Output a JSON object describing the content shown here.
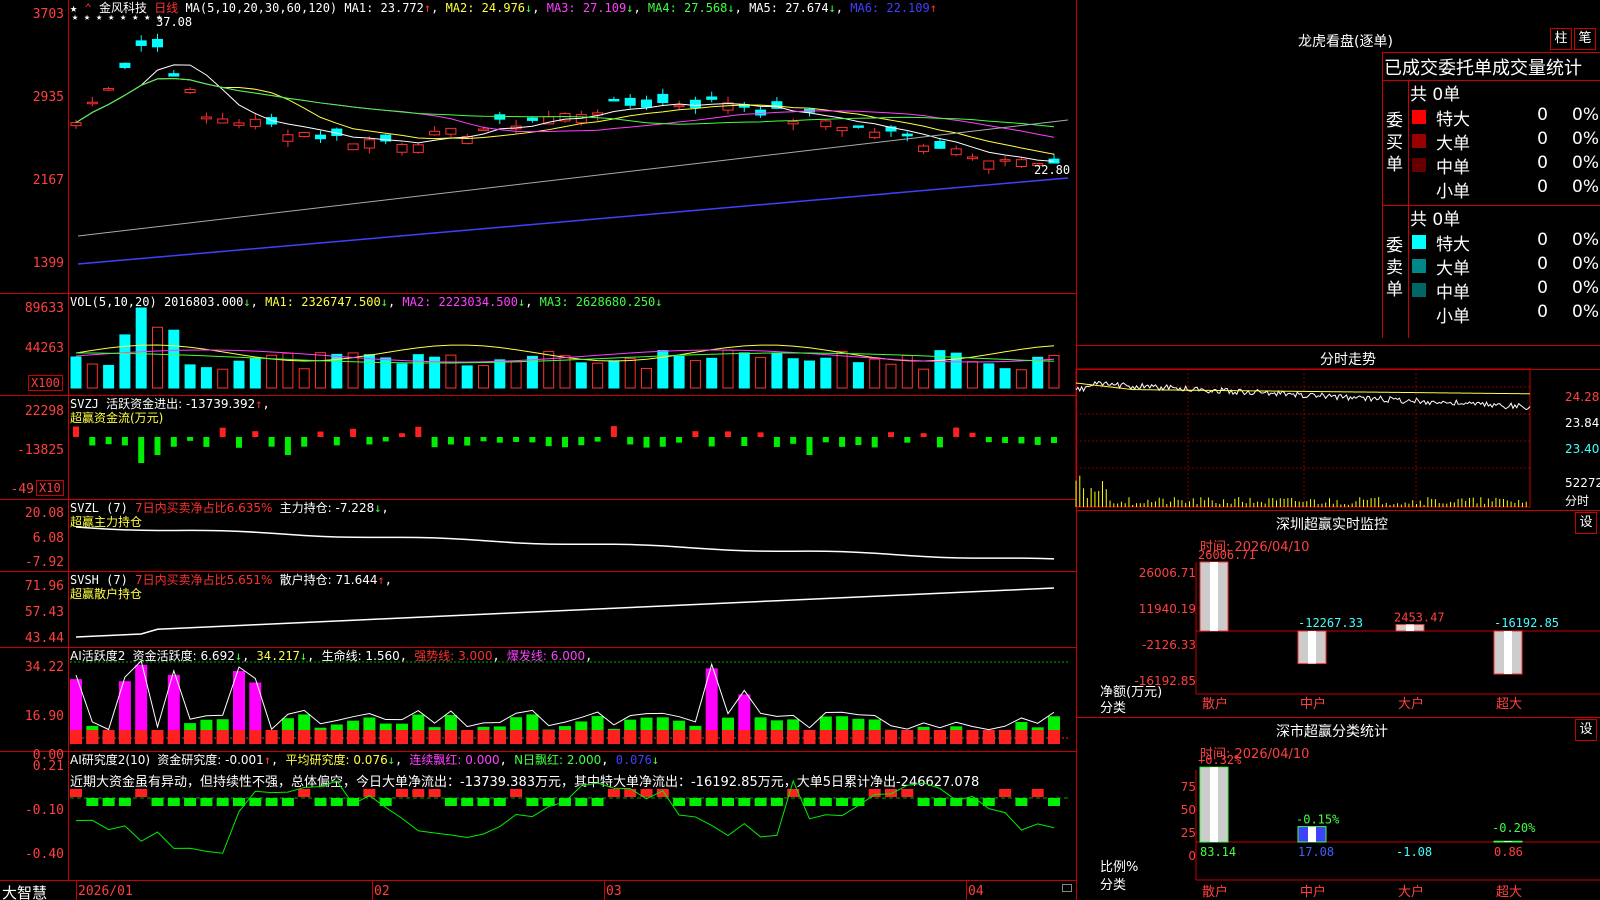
{
  "main_chart": {
    "stock_name": "金风科技",
    "period": "日线",
    "ma_prefix": "MA(5,10,20,30,60,120)",
    "ma1": "MA1: 23.772",
    "ma2": "MA2: 24.976",
    "ma3": "MA3: 27.109",
    "ma4": "MA4: 27.568",
    "ma5": "MA5: 27.674",
    "ma6": "MA6: 22.109",
    "y_ticks": [
      "3703",
      "2935",
      "2167",
      "1399"
    ],
    "high_label": "37.08",
    "low_label": "22.80",
    "stars": "★ ★ ★ ★ ★    ★ ★    ★"
  },
  "vol_panel": {
    "title": "VOL(5,10,20)",
    "value": "2016803.000",
    "ma1": "MA1: 2326747.500",
    "ma2": "MA2: 2223034.500",
    "ma3": "MA3: 2628680.250",
    "y_ticks": [
      "89633",
      "44263"
    ],
    "unit": "X100"
  },
  "svzj_panel": {
    "title": "SVZJ",
    "value": "活跃资金进出: -13739.392",
    "subtitle": "超赢资金流(万元)",
    "y_ticks": [
      "22298",
      "-13825",
      "-49"
    ],
    "unit": "X10"
  },
  "svzl_panel": {
    "title": "SVZL (7)",
    "ratio": "7日内买卖净占比6.635%",
    "value": "主力持仓: -7.228",
    "subtitle": "超赢主力持仓",
    "y_ticks": [
      "20.08",
      "6.08",
      "-7.92"
    ]
  },
  "svsh_panel": {
    "title": "SVSH (7)",
    "ratio": "7日内买卖净占比5.651%",
    "value": "散户持仓: 71.644",
    "subtitle": "超赢散户持仓",
    "y_ticks": [
      "71.96",
      "57.43",
      "43.44"
    ]
  },
  "ai_active_panel": {
    "title": "AI活跃度2",
    "v1": "资金活跃度: 6.692",
    "v2": "34.217",
    "v3": "生命线: 1.560",
    "v4": "强势线: 3.000",
    "v5": "爆发线: 6.000",
    "y_ticks": [
      "34.22",
      "16.90",
      "0.00"
    ]
  },
  "ai_research_panel": {
    "title": "AI研究度2(10)",
    "v1": "资金研究度: -0.001",
    "v2": "平均研究度: 0.076",
    "v3": "连续飘红: 0.000",
    "v4": "N日飘红: 2.000",
    "v5": "0.076",
    "comment": "近期大资金虽有异动，但持续性不强，总体偏空，今日大单净流出：-13739.383万元，其中特大单净流出：-16192.85万元，大单5日累计净出-246627.078",
    "y_ticks": [
      "0.21",
      "-0.10",
      "-0.40"
    ]
  },
  "footer": {
    "brand": "大智慧",
    "dates": [
      "2026/01",
      "02",
      "03",
      "04"
    ]
  },
  "dragon_tiger": {
    "title": "龙虎看盘(逐单)",
    "btn_bar": "柱",
    "btn_stroke": "笔",
    "tabs": "已成交委托单成交量统计",
    "buy_section": {
      "label": "委买单",
      "total": "共 0单",
      "rows": [
        {
          "name": "特大",
          "count": "0",
          "pct": "0%",
          "color": "#ff0000"
        },
        {
          "name": "大单",
          "count": "0",
          "pct": "0%",
          "color": "#990000"
        },
        {
          "name": "中单",
          "count": "0",
          "pct": "0%",
          "color": "#660000"
        },
        {
          "name": "小单",
          "count": "0",
          "pct": "0%",
          "color": ""
        }
      ]
    },
    "sell_section": {
      "label": "委卖单",
      "total": "共 0单",
      "rows": [
        {
          "name": "特大",
          "count": "0",
          "pct": "0%",
          "color": "#00ffff"
        },
        {
          "name": "大单",
          "count": "0",
          "pct": "0%",
          "color": "#008888"
        },
        {
          "name": "中单",
          "count": "0",
          "pct": "0%",
          "color": "#006666"
        },
        {
          "name": "小单",
          "count": "0",
          "pct": "0%",
          "color": ""
        }
      ]
    }
  },
  "intraday": {
    "title": "分时走势",
    "right_labels": [
      "24.28",
      "23.84",
      "23.40",
      "52272",
      "分时"
    ]
  },
  "sz_monitor": {
    "title": "深圳超赢实时监控",
    "btn": "设",
    "time": "时间: 2026/04/10",
    "y_ticks": [
      "26006.71",
      "11940.19",
      "-2126.33",
      "-16192.85"
    ],
    "y_label1": "净额(万元)",
    "y_label2": "分类",
    "bars": [
      {
        "name": "散户",
        "value": "26006.71",
        "num": 26006.71
      },
      {
        "name": "中户",
        "value": "-12267.33",
        "num": -12267.33
      },
      {
        "name": "大户",
        "value": "2453.47",
        "num": 2453.47
      },
      {
        "name": "超大",
        "value": "-16192.85",
        "num": -16192.85
      }
    ]
  },
  "sz_class": {
    "title": "深市超赢分类统计",
    "btn": "设",
    "time": "时间: 2026/04/10",
    "y_ticks": [
      "75",
      "50",
      "25",
      "0"
    ],
    "y_label1": "比例%",
    "y_label2": "分类",
    "bars": [
      {
        "name": "散户",
        "top": "+0.32%",
        "bottom": "83.14",
        "num": 83.14
      },
      {
        "name": "中户",
        "top": "-0.15%",
        "bottom": "17.08",
        "num": 17.08
      },
      {
        "name": "大户",
        "top": "",
        "bottom": "-1.08",
        "num": -1.08
      },
      {
        "name": "超大",
        "top": "-0.20%",
        "bottom": "0.86",
        "num": 0.86
      }
    ]
  },
  "colors": {
    "grid": "#cc0000",
    "up": "#ff3030",
    "down": "#00ffff",
    "green": "#00ee00",
    "magenta": "#ff00ff"
  }
}
